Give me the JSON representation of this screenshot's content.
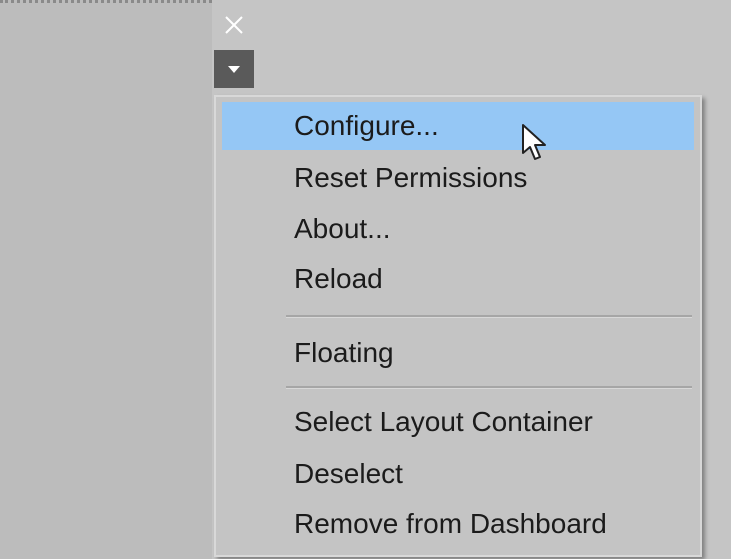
{
  "toolbar": {
    "close_icon": "close-icon",
    "dropdown_icon": "chevron-down-icon"
  },
  "menu": {
    "items": [
      {
        "label": "Configure...",
        "highlighted": true
      },
      {
        "label": "Reset Permissions"
      },
      {
        "label": "About..."
      },
      {
        "label": "Reload"
      },
      {
        "label": "Floating"
      },
      {
        "label": "Select Layout Container"
      },
      {
        "label": "Deselect"
      },
      {
        "label": "Remove from Dashboard"
      }
    ]
  },
  "colors": {
    "highlight": "#95c7f5",
    "menu_background": "#c4c4c4",
    "text": "#1b1b1b"
  }
}
